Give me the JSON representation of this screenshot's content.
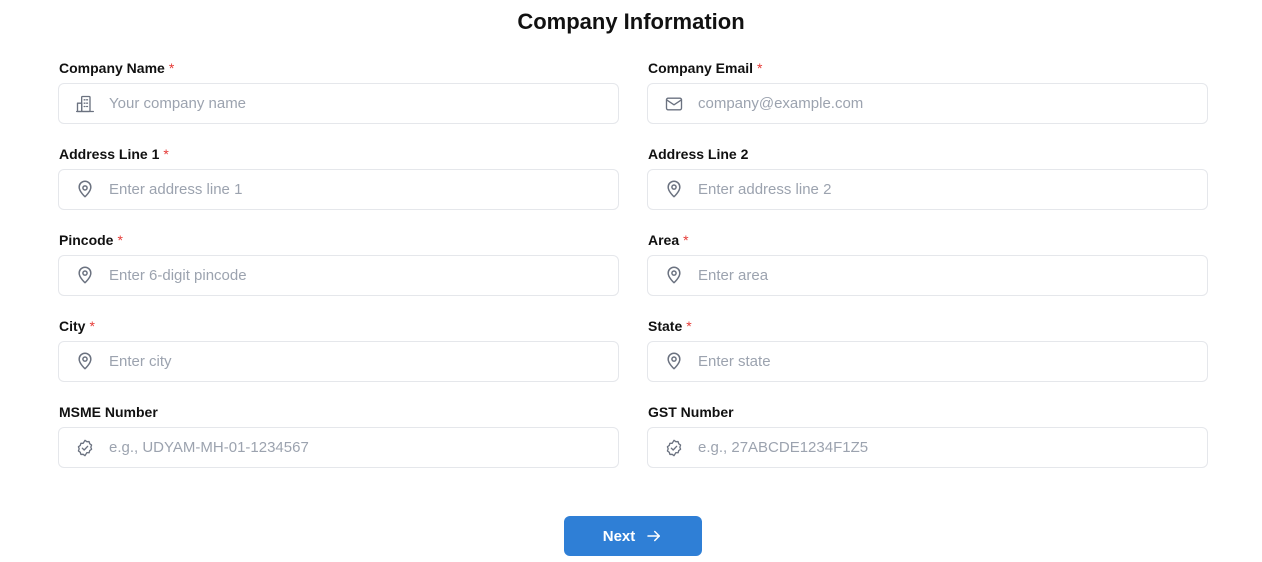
{
  "page": {
    "title": "Company Information"
  },
  "form": {
    "required_mark": "*",
    "fields": [
      {
        "label": "Company Name",
        "required": true,
        "placeholder": "Your company name",
        "value": "",
        "icon": "building-icon"
      },
      {
        "label": "Company Email",
        "required": true,
        "placeholder": "company@example.com",
        "value": "",
        "icon": "mail-icon"
      },
      {
        "label": "Address Line 1",
        "required": true,
        "placeholder": "Enter address line 1",
        "value": "",
        "icon": "map-pin-icon"
      },
      {
        "label": "Address Line 2",
        "required": false,
        "placeholder": "Enter address line 2",
        "value": "",
        "icon": "map-pin-icon"
      },
      {
        "label": "Pincode",
        "required": true,
        "placeholder": "Enter 6-digit pincode",
        "value": "",
        "icon": "map-pin-icon"
      },
      {
        "label": "Area",
        "required": true,
        "placeholder": "Enter area",
        "value": "",
        "icon": "map-pin-icon"
      },
      {
        "label": "City",
        "required": true,
        "placeholder": "Enter city",
        "value": "",
        "icon": "map-pin-icon"
      },
      {
        "label": "State",
        "required": true,
        "placeholder": "Enter state",
        "value": "",
        "icon": "map-pin-icon"
      },
      {
        "label": "MSME Number",
        "required": false,
        "placeholder": "e.g., UDYAM-MH-01-1234567",
        "value": "",
        "icon": "verified-badge-icon"
      },
      {
        "label": "GST Number",
        "required": false,
        "placeholder": "e.g., 27ABCDE1234F1Z5",
        "value": "",
        "icon": "verified-badge-icon"
      }
    ]
  },
  "actions": {
    "next_label": "Next",
    "next_icon": "arrow-right-icon"
  },
  "colors": {
    "primary": "#2f7fd6",
    "required": "#e53935",
    "icon": "#6b7280",
    "border": "#e5e7eb",
    "placeholder": "#9ca3af"
  }
}
